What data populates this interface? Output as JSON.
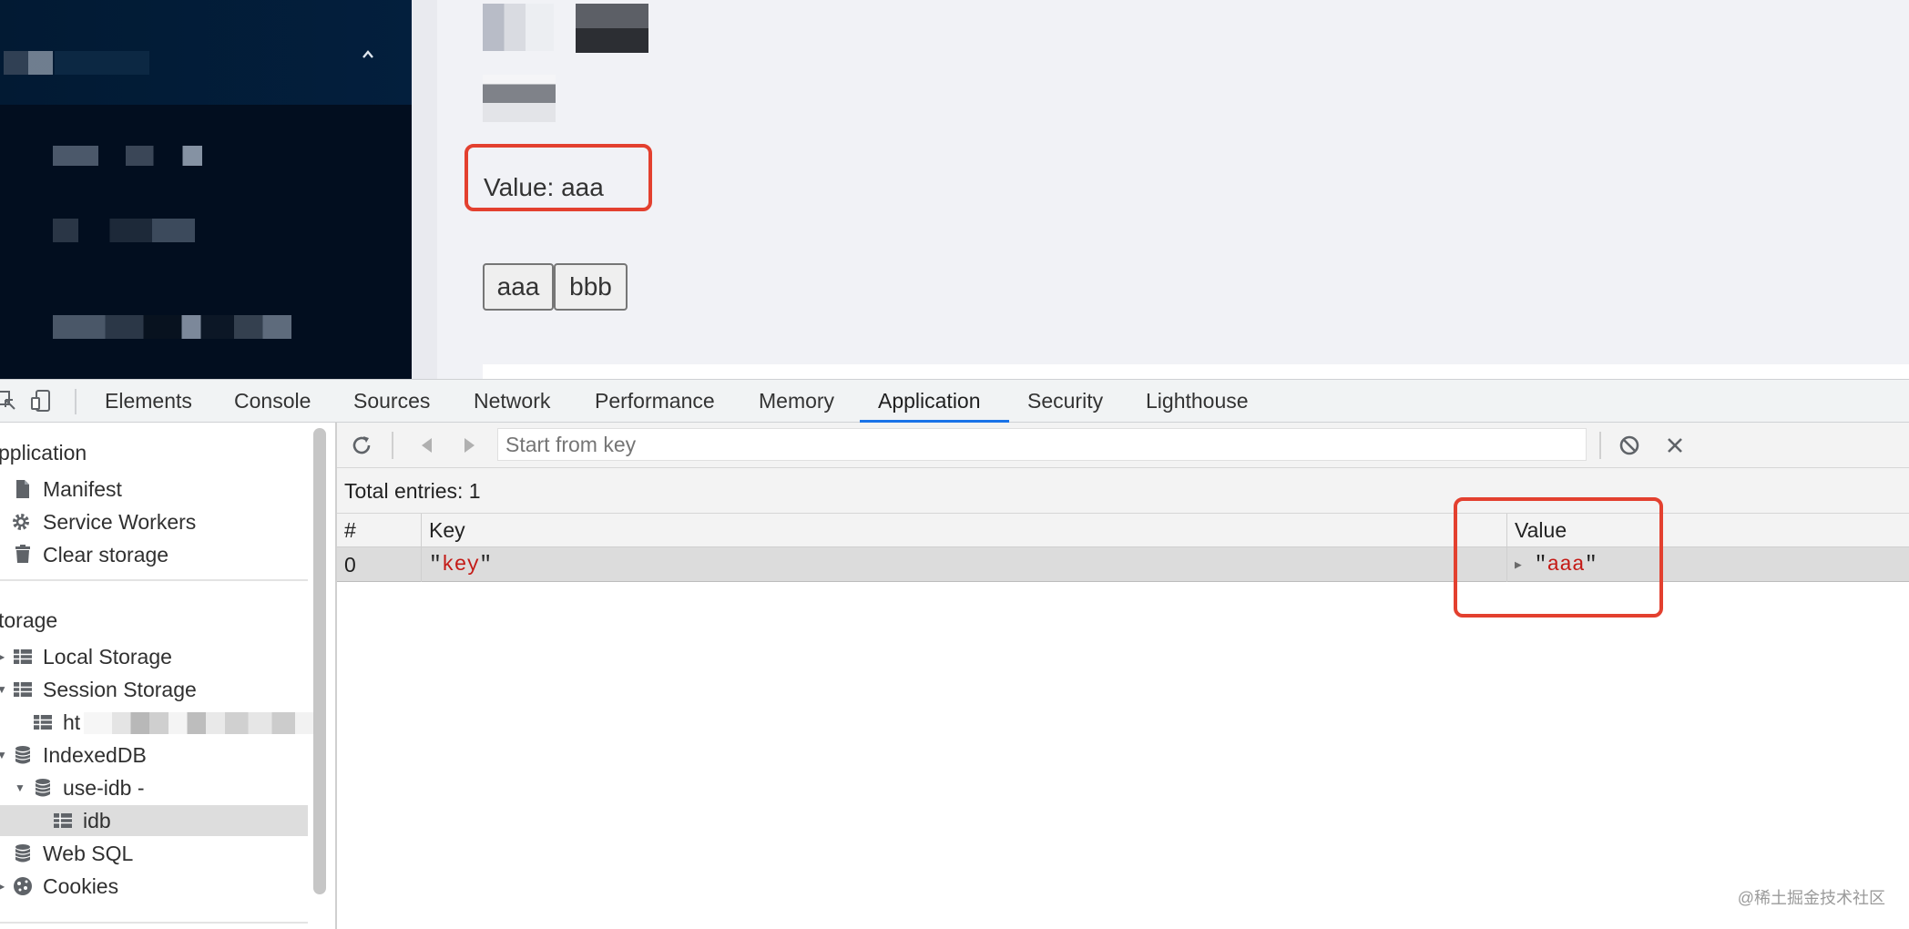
{
  "page": {
    "value_label": "Value: aaa",
    "buttons": [
      "aaa",
      "bbb"
    ]
  },
  "devtools": {
    "tabs": [
      "Elements",
      "Console",
      "Sources",
      "Network",
      "Performance",
      "Memory",
      "Application",
      "Security",
      "Lighthouse"
    ],
    "active_tab": "Application",
    "sidebar": {
      "application_header": "pplication",
      "application_items": [
        "Manifest",
        "Service Workers",
        "Clear storage"
      ],
      "storage_header": "torage",
      "storage_items": {
        "local_storage": "Local Storage",
        "session_storage": "Session Storage",
        "session_origin": "ht",
        "indexeddb": "IndexedDB",
        "db": "use-idb - ",
        "store": "idb",
        "web_sql": "Web SQL",
        "cookies": "Cookies"
      }
    },
    "toolbar": {
      "search_placeholder": "Start from key"
    },
    "total_entries": "Total entries: 1",
    "table": {
      "headers": [
        "#",
        "Key",
        "Value"
      ],
      "rows": [
        {
          "index": "0",
          "key": "key",
          "value": "aaa"
        }
      ]
    }
  },
  "watermark": "@稀土掘金技术社区",
  "colors": {
    "highlight_box": "#e3402f",
    "string_value": "#c41a16",
    "active_tab_underline": "#1a73e8",
    "nav_bg": "#020e1f"
  }
}
